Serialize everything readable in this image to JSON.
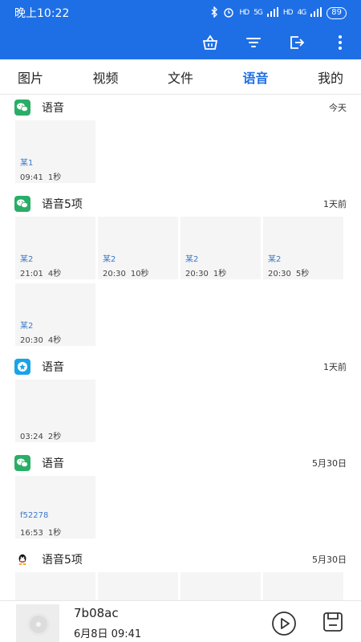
{
  "status": {
    "time": "晚上10:22",
    "net1": "5G",
    "net2": "4G",
    "battery": "89"
  },
  "toolbar": {
    "icons": [
      "basket-icon",
      "filter-icon",
      "export-icon",
      "more-vert-icon"
    ]
  },
  "tabs": [
    {
      "label": "图片",
      "active": false
    },
    {
      "label": "视频",
      "active": false
    },
    {
      "label": "文件",
      "active": false
    },
    {
      "label": "语音",
      "active": true
    },
    {
      "label": "我的",
      "active": false
    }
  ],
  "colors": {
    "brand": "#1e6fe6",
    "wechat": "#2aae67",
    "qq_blue": "#1aa3e8"
  },
  "groups": [
    {
      "app": "wechat",
      "title": "语音",
      "date": "今天",
      "items": [
        {
          "name": "某1",
          "time": "09:41",
          "duration": "1秒"
        }
      ]
    },
    {
      "app": "wechat",
      "title": "语音5项",
      "date": "1天前",
      "items": [
        {
          "name": "某2",
          "time": "21:01",
          "duration": "4秒"
        },
        {
          "name": "某2",
          "time": "20:30",
          "duration": "10秒"
        },
        {
          "name": "某2",
          "time": "20:30",
          "duration": "1秒"
        },
        {
          "name": "某2",
          "time": "20:30",
          "duration": "5秒"
        },
        {
          "name": "某2",
          "time": "20:30",
          "duration": "4秒"
        }
      ]
    },
    {
      "app": "star",
      "title": "语音",
      "date": "1天前",
      "items": [
        {
          "name": "",
          "time": "03:24",
          "duration": "2秒"
        }
      ]
    },
    {
      "app": "wechat",
      "title": "语音",
      "date": "5月30日",
      "items": [
        {
          "name": "f52278",
          "time": "16:53",
          "duration": "1秒"
        }
      ]
    },
    {
      "app": "qq",
      "title": "语音5项",
      "date": "5月30日",
      "items": [
        {
          "name": "",
          "time": "",
          "duration": ""
        },
        {
          "name": "",
          "time": "",
          "duration": ""
        },
        {
          "name": "",
          "time": "",
          "duration": ""
        },
        {
          "name": "",
          "time": "",
          "duration": ""
        }
      ]
    }
  ],
  "player": {
    "title": "7b08ac",
    "subtitle": "6月8日  09:41"
  }
}
